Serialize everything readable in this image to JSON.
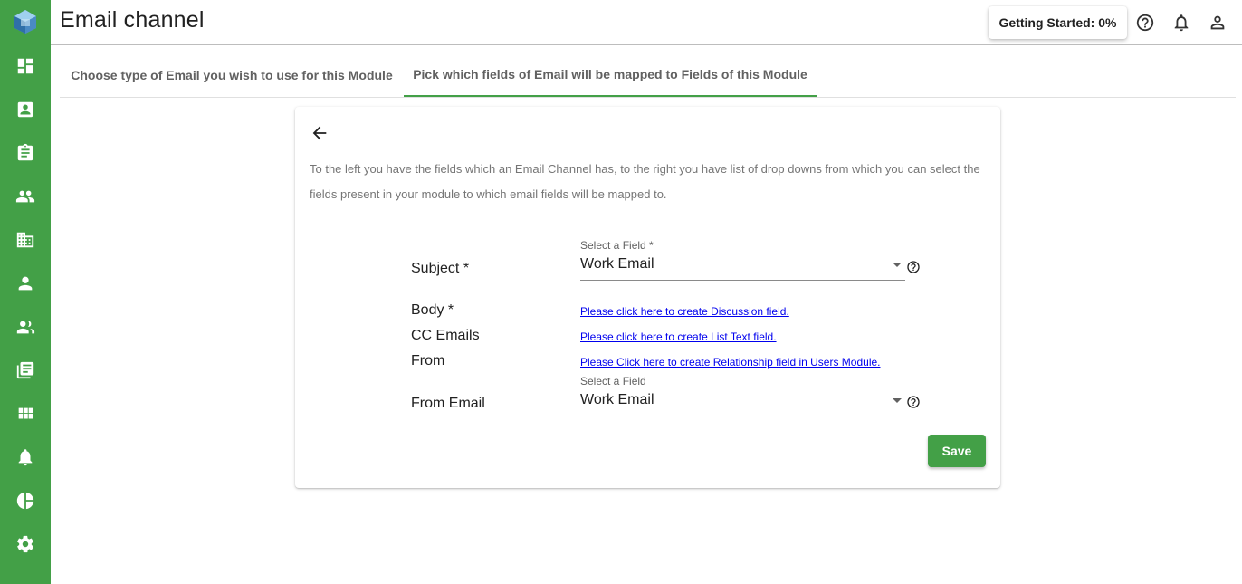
{
  "sidebar": {
    "items": [
      {
        "icon": "dashboard-icon"
      },
      {
        "icon": "contact-card-icon"
      },
      {
        "icon": "assignment-icon"
      },
      {
        "icon": "people-icon"
      },
      {
        "icon": "business-icon"
      },
      {
        "icon": "person-icon"
      },
      {
        "icon": "people-outline-icon"
      },
      {
        "icon": "library-books-icon"
      },
      {
        "icon": "apps-grid-icon"
      },
      {
        "icon": "notifications-icon"
      },
      {
        "icon": "pie-chart-icon"
      },
      {
        "icon": "settings-icon"
      }
    ],
    "color": "#43a047"
  },
  "header": {
    "title": "Email channel",
    "getting_started": "Getting Started: 0%"
  },
  "tabs": [
    {
      "label": "Choose type of Email you wish to use for this Module",
      "active": false
    },
    {
      "label": "Pick which fields of Email will be mapped to Fields of this Module",
      "active": true
    }
  ],
  "card": {
    "instructions": "To the left you have the fields which an Email Channel has, to the right you have list of drop downs from which you can select the fields present in your module to which email fields will be mapped to.",
    "fields": {
      "subject": {
        "label": "Subject *",
        "caption": "Select a Field *",
        "value": "Work Email"
      },
      "body": {
        "label": "Body *",
        "link": "Please click here to create Discussion field."
      },
      "cc_emails": {
        "label": "CC Emails",
        "link": "Please click here to create List Text field."
      },
      "from": {
        "label": "From",
        "link": "Please Click here to create Relationship field in Users Module."
      },
      "from_email": {
        "label": "From Email",
        "caption": "Select a Field",
        "value": "Work Email"
      }
    },
    "save_label": "Save"
  },
  "colors": {
    "accent": "#43a047",
    "link": "#0000ee"
  }
}
